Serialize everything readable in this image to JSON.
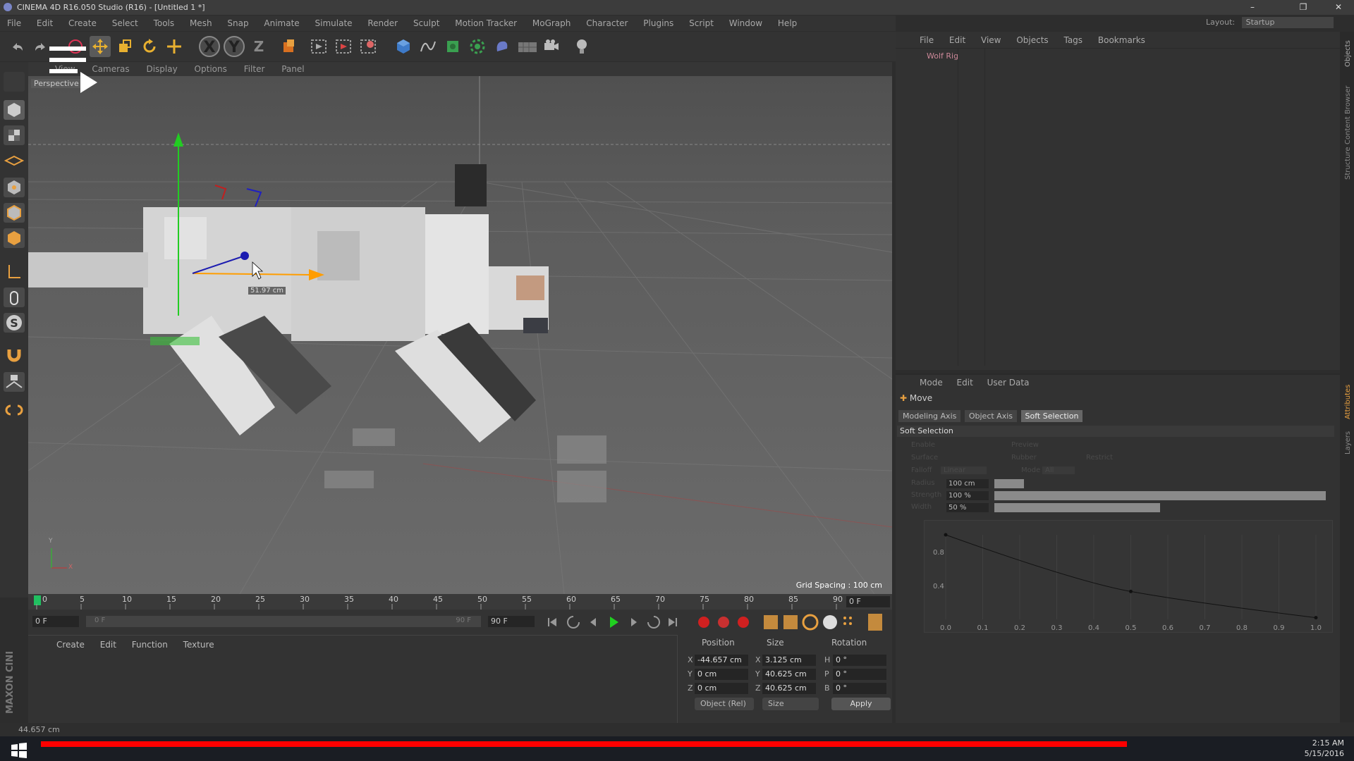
{
  "window": {
    "title": "CINEMA 4D R16.050 Studio (R16) - [Untitled 1 *]",
    "controls": [
      "–",
      "❐",
      "✕"
    ]
  },
  "menubar": {
    "items": [
      "File",
      "Edit",
      "Create",
      "Select",
      "Tools",
      "Mesh",
      "Snap",
      "Animate",
      "Simulate",
      "Render",
      "Sculpt",
      "Motion Tracker",
      "MoGraph",
      "Character",
      "Plugins",
      "Script",
      "Window",
      "Help"
    ],
    "layout_label": "Layout:",
    "layout_value": "Startup"
  },
  "toolbar": {
    "icons": [
      "undo-icon",
      "redo-icon",
      "live-selection-icon",
      "move-icon",
      "scale-icon",
      "rotate-icon",
      "add-axis-icon",
      "x-axis-lock-icon",
      "y-axis-lock-icon",
      "z-axis-lock-icon",
      "coordinate-system-icon",
      "render-view-icon",
      "render-picture-viewer-icon",
      "edit-render-settings-icon",
      "cube-icon",
      "spline-pen-icon",
      "subdivision-icon",
      "array-icon",
      "deformer-icon",
      "floor-icon",
      "camera-icon",
      "light-icon"
    ],
    "x_label": "X",
    "y_label": "Y",
    "z_label": "Z"
  },
  "left_tools": [
    "make-editable-icon",
    "model-mode-icon",
    "texture-mode-icon",
    "workplane-icon",
    "points-mode-icon",
    "edges-mode-icon",
    "polygons-mode-icon",
    "axis-icon",
    "tweak-icon",
    "solo-icon",
    "magnet-icon",
    "snap-icon",
    "lock-workplane-icon"
  ],
  "viewport": {
    "menu": [
      "View",
      "Cameras",
      "Display",
      "Options",
      "Filter",
      "Panel"
    ],
    "label": "Perspective",
    "measure": "51.97 cm",
    "grid_spacing": "Grid Spacing : 100 cm",
    "axis_y": "Y",
    "axis_x": "X"
  },
  "timeline": {
    "ticks": [
      "0",
      "5",
      "10",
      "15",
      "20",
      "25",
      "30",
      "35",
      "40",
      "45",
      "50",
      "55",
      "60",
      "65",
      "70",
      "75",
      "80",
      "85",
      "90"
    ],
    "current_frame": "0 F",
    "start": "0 F",
    "range_start": "0 F",
    "range_end": "90 F",
    "end": "90 F"
  },
  "material_manager": {
    "menu": [
      "Create",
      "Edit",
      "Function",
      "Texture"
    ]
  },
  "coordinates": {
    "headers": [
      "Position",
      "Size",
      "Rotation"
    ],
    "rows": [
      {
        "axis": "X",
        "pos": "-44.657 cm",
        "size_axis": "X",
        "size": "3.125 cm",
        "rot_axis": "H",
        "rot": "0 °"
      },
      {
        "axis": "Y",
        "pos": "0 cm",
        "size_axis": "Y",
        "size": "40.625 cm",
        "rot_axis": "P",
        "rot": "0 °"
      },
      {
        "axis": "Z",
        "pos": "0 cm",
        "size_axis": "Z",
        "size": "40.625 cm",
        "rot_axis": "B",
        "rot": "0 °"
      }
    ],
    "mode": "Object (Rel)",
    "size_mode": "Size",
    "apply": "Apply"
  },
  "status": "44.657 cm",
  "logo": "MAXON CINEMA 4D",
  "objects": {
    "menu": [
      "File",
      "Edit",
      "View",
      "Objects",
      "Tags",
      "Bookmarks"
    ],
    "item": "Wolf Rig"
  },
  "side_tabs": [
    "Objects",
    "Content Browser",
    "Structure",
    "Attributes",
    "Layers"
  ],
  "attributes": {
    "menu": [
      "Mode",
      "Edit",
      "User Data"
    ],
    "tool": "Move",
    "tabs": [
      "Modeling Axis",
      "Object Axis",
      "Soft Selection"
    ],
    "active_tab": "Soft Selection",
    "section": "Soft Selection",
    "props_dim": [
      {
        "label": "Enable",
        "col": 1
      },
      {
        "label": "Preview",
        "col": 2
      },
      {
        "label": "Surface",
        "col": 1
      },
      {
        "label": "Rubber",
        "col": 2
      },
      {
        "label": "Restrict",
        "col": 3
      },
      {
        "label": "Falloff",
        "col": 1
      },
      {
        "label": "Linear",
        "col": 1
      },
      {
        "label": "Mode",
        "col": 2
      },
      {
        "label": "All",
        "col": 2
      }
    ],
    "sliders": [
      {
        "label": "Radius",
        "value": "100 cm",
        "fill": 0.09
      },
      {
        "label": "Strength",
        "value": "100 %",
        "fill": 1.0
      },
      {
        "label": "Width",
        "value": "50 %",
        "fill": 0.5
      }
    ],
    "graph": {
      "y_ticks": [
        "0.8",
        "0.4"
      ],
      "x_ticks": [
        "0.0",
        "0.1",
        "0.2",
        "0.3",
        "0.4",
        "0.5",
        "0.6",
        "0.7",
        "0.8",
        "0.9",
        "1.0"
      ],
      "curve": [
        [
          0.0,
          1.0
        ],
        [
          0.5,
          0.33
        ],
        [
          1.0,
          0.02
        ]
      ]
    }
  },
  "taskbar": {
    "time": "2:15 AM",
    "date": "5/15/2016"
  },
  "overlays": [
    "menu-overlay-icon",
    "play-overlay-icon",
    "watch-later-icon",
    "share-icon"
  ]
}
